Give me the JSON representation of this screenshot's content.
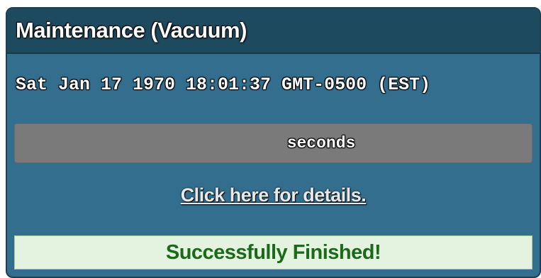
{
  "panel": {
    "title": "Maintenance (Vacuum)",
    "timestamp": "Sat Jan 17 1970 18:01:37 GMT-0500 (EST)",
    "progress": {
      "label": "seconds",
      "fill_fraction": 0.0,
      "track_color": "#7a7a7a"
    },
    "details_link": "Click here for details.",
    "status": "Successfully Finished!",
    "colors": {
      "panel_bg": "#336e8e",
      "header_bg": "#1e4a5f",
      "status_bg": "#e4f2e0",
      "status_text": "#1a6a1a"
    }
  }
}
